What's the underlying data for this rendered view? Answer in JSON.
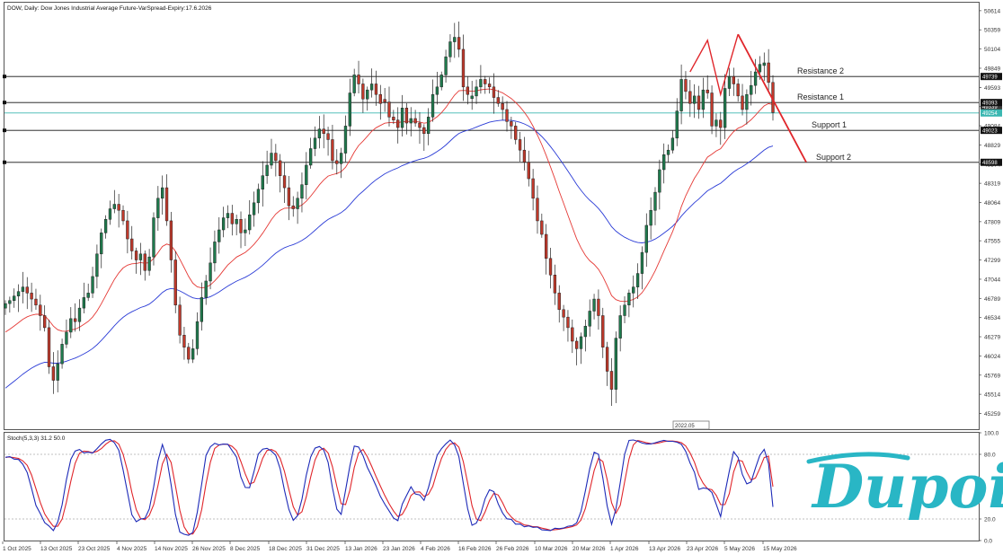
{
  "header": {
    "symbol_line": "DOW, Daily: Dow Jones Industrial Average Future-VarSpread-Expiry:17.6.2026"
  },
  "logo": {
    "text": "Dupoin",
    "color": "#29b6c5"
  },
  "colors": {
    "bull": "#1f7a4d",
    "bear": "#c0392b",
    "ma_fast": "#e53935",
    "ma_slow": "#2a3bd6",
    "stoch_main": "#1d2ab8",
    "stoch_signal": "#e0262b",
    "trendline": "#e0262b",
    "current": "#3bb7b1"
  },
  "chart_data": [
    {
      "type": "candlestick",
      "title": "DOW, Daily: Dow Jones Industrial Average Future-VarSpread-Expiry:17.6.2026",
      "y_ticks": [
        50614,
        50359,
        50104,
        49849,
        49593,
        49339,
        49084,
        48829,
        48574,
        48319,
        48064,
        47809,
        47555,
        47299,
        47044,
        46789,
        46534,
        46279,
        46024,
        45769,
        45514,
        45259
      ],
      "ylim": [
        45050,
        50720
      ],
      "x_ticks": [
        "1 Oct 2025",
        "13 Oct 2025",
        "23 Oct 2025",
        "4 Nov 2025",
        "14 Nov 2025",
        "26 Nov 2025",
        "8 Dec 2025",
        "18 Dec 2025",
        "31 Dec 2025",
        "13 Jan 2026",
        "23 Jan 2026",
        "4 Feb 2026",
        "16 Feb 2026",
        "26 Feb 2026",
        "10 Mar 2026",
        "20 Mar 2026",
        "1 Apr 2026",
        "13 Apr 2026",
        "23 Apr 2026",
        "5 May 2026",
        "15 May 2026"
      ],
      "levels": [
        {
          "label": "Resistance 2",
          "price": 49739,
          "tag": "49739"
        },
        {
          "label": "Resistance 1",
          "price": 49393,
          "tag": "49393"
        },
        {
          "label": "Support 1",
          "price": 49023,
          "tag": "49023"
        },
        {
          "label": "Support 2",
          "price": 48598,
          "tag": "48598"
        }
      ],
      "current_price": {
        "value": 49254,
        "tag": "49254"
      },
      "hidden_tag": "49339",
      "trendline": [
        {
          "date": "5 May 2026",
          "price": 50300
        },
        {
          "date": "15 May 2026",
          "price": 48600
        }
      ],
      "period_separator_tag": "2022.05",
      "series": [
        {
          "name": "candles",
          "closes": [
            46720,
            46760,
            46820,
            46880,
            46940,
            46860,
            46780,
            46700,
            46560,
            46400,
            45880,
            45700,
            45920,
            46180,
            46340,
            46520,
            46480,
            46660,
            46800,
            46860,
            47080,
            47380,
            47660,
            47840,
            47980,
            48040,
            47960,
            47820,
            47580,
            47420,
            47300,
            47380,
            47160,
            47340,
            47860,
            48120,
            48260,
            47820,
            47300,
            46700,
            46300,
            46140,
            45980,
            46120,
            46480,
            46800,
            47020,
            47260,
            47540,
            47700,
            47860,
            47920,
            47780,
            47840,
            47660,
            47700,
            47900,
            48060,
            48240,
            48420,
            48560,
            48720,
            48620,
            48420,
            48260,
            48020,
            47980,
            48120,
            48300,
            48560,
            48780,
            48920,
            49040,
            48980,
            48900,
            48620,
            48580,
            48720,
            49080,
            49520,
            49760,
            49640,
            49440,
            49560,
            49640,
            49500,
            49380,
            49400,
            49200,
            49160,
            49060,
            49320,
            49120,
            49180,
            49120,
            49060,
            48980,
            49200,
            49500,
            49600,
            49760,
            50000,
            50200,
            50260,
            50100,
            49600,
            49500,
            49480,
            49600,
            49700,
            49640,
            49600,
            49460,
            49380,
            49300,
            49140,
            49080,
            48900,
            48760,
            48600,
            48380,
            48120,
            47820,
            47640,
            47320,
            47100,
            46860,
            46640,
            46540,
            46400,
            46220,
            46120,
            46280,
            46420,
            46620,
            46780,
            46560,
            46140,
            45820,
            45580,
            46260,
            46560,
            46700,
            46860,
            46940,
            47120,
            47400,
            47760,
            47960,
            48200,
            48500,
            48700,
            48760,
            48920,
            49280,
            49700,
            49540,
            49380,
            49480,
            49300,
            49560,
            49520,
            49080,
            49160,
            49060,
            49580,
            49740,
            49640,
            49480,
            49300,
            49500,
            49620,
            49800,
            49900,
            49920,
            49660,
            49260
          ]
        },
        {
          "name": "MA fast",
          "start": 46300,
          "end": 49300
        },
        {
          "name": "MA slow",
          "start": 45550,
          "end": 48830
        }
      ]
    },
    {
      "type": "line",
      "title": "Stoch(5,3,3) 31.2 50.0",
      "y_ticks": [
        "100.0",
        "80.0",
        "20.0",
        "0.0"
      ],
      "ylim": [
        0,
        100
      ],
      "series": [
        {
          "name": "main",
          "value": 31.2
        },
        {
          "name": "signal",
          "value": 50.0
        }
      ]
    }
  ]
}
